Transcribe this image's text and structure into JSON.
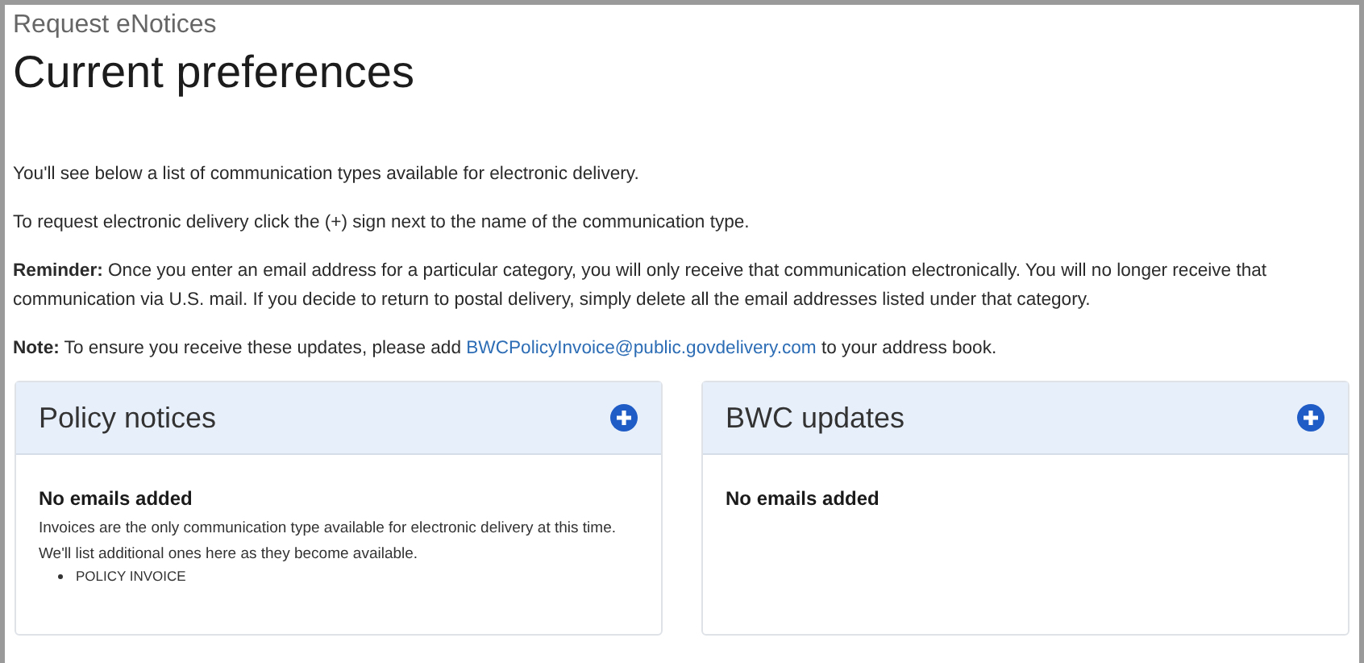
{
  "page": {
    "breadcrumb": "Request eNotices",
    "title": "Current preferences"
  },
  "intro": [
    {
      "kind": "text",
      "text": "You'll see below a list of communication types available for electronic delivery."
    },
    {
      "kind": "text",
      "text": "To request electronic delivery click the (+) sign next to the name of the communication type."
    },
    {
      "kind": "text",
      "text": "**Reminder:** Once you enter an email address for a particular category, you will only receive that communication electronically. You will no longer receive that communication via U.S. mail. If you decide to return to postal delivery, simply delete all the email addresses listed under that category."
    },
    {
      "kind": "link",
      "before": "**Note:** To ensure you receive these updates, please add ",
      "link": "BWCPolicyInvoice@public.govdelivery.com",
      "after": " to your address book."
    }
  ],
  "cards": [
    {
      "title": "Policy notices",
      "status": "No emails added",
      "notes": [
        "Invoices are the only communication type available for electronic delivery at this time.",
        "We'll list additional ones here as they become available."
      ],
      "items": [
        "POLICY INVOICE"
      ]
    },
    {
      "title": "BWC updates",
      "status": "No emails added"
    }
  ]
}
